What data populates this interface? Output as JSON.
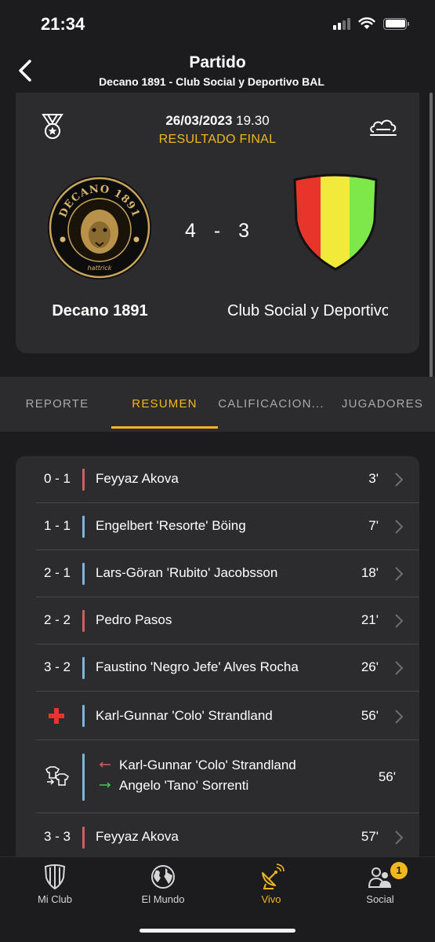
{
  "status_bar": {
    "time": "21:34"
  },
  "nav": {
    "title": "Partido",
    "subtitle": "Decano 1891 - Club Social y Deportivo BAL"
  },
  "match": {
    "date": "26/03/2023",
    "time": "19.30",
    "status": "RESULTADO FINAL",
    "home_team": "Decano 1891",
    "away_team": "Club Social y Deportivo",
    "home_goals": "4",
    "separator": "-",
    "away_goals": "3",
    "home_logo_text": "DECANO 1891",
    "home_logo_sub": "hattrick",
    "away_colors": [
      "#e8352b",
      "#f2ea3a",
      "#7ee84b"
    ]
  },
  "tabs": [
    {
      "label": "REPORTE",
      "active": false
    },
    {
      "label": "RESUMEN",
      "active": true
    },
    {
      "label": "CALIFICACION...",
      "active": false
    },
    {
      "label": "JUGADORES",
      "active": false
    }
  ],
  "events": [
    {
      "score": "0 - 1",
      "player": "Feyyaz Akova",
      "minute": "3'",
      "team": "away"
    },
    {
      "score": "1 - 1",
      "player": "Engelbert 'Resorte' Böing",
      "minute": "7'",
      "team": "home"
    },
    {
      "score": "2 - 1",
      "player": "Lars-Göran 'Rubito' Jacobsson",
      "minute": "18'",
      "team": "home"
    },
    {
      "score": "2 - 2",
      "player": "Pedro Pasos",
      "minute": "21'",
      "team": "away"
    },
    {
      "score": "3 - 2",
      "player": "Faustino 'Negro Jefe' Alves Rocha",
      "minute": "26'",
      "team": "home"
    },
    {
      "icon": "injury-cross-icon",
      "player": "Karl-Gunnar 'Colo' Strandland",
      "minute": "56'",
      "team": "home"
    },
    {
      "icon": "substitution-icon",
      "player_out": "Karl-Gunnar 'Colo' Strandland",
      "player_in": "Angelo 'Tano' Sorrenti",
      "minute": "56'",
      "team": "home"
    },
    {
      "score": "3 - 3",
      "player": "Feyyaz Akova",
      "minute": "57'",
      "team": "away"
    }
  ],
  "bottom_nav": [
    {
      "label": "Mi Club",
      "icon": "shield-icon",
      "active": false
    },
    {
      "label": "El Mundo",
      "icon": "globe-icon",
      "active": false
    },
    {
      "label": "Vivo",
      "icon": "satellite-dish-icon",
      "active": true
    },
    {
      "label": "Social",
      "icon": "people-icon",
      "active": false,
      "badge": "1"
    }
  ],
  "colors": {
    "accent": "#f0b81e",
    "home_bar": "#7cb6dc",
    "away_bar": "#c9625a",
    "injury": "#e8352b",
    "sub_out": "#e05a5a",
    "sub_in": "#4cc25a"
  }
}
